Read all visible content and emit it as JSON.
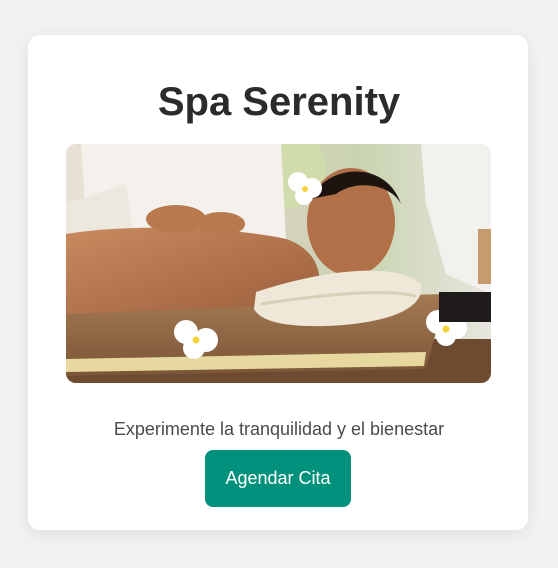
{
  "card": {
    "title": "Spa Serenity",
    "image": {
      "subject": "woman receiving back massage on a towel with white plumeria flowers"
    },
    "tagline": "Experimente la tranquilidad y el bienestar",
    "cta_label": "Agendar Cita"
  },
  "colors": {
    "page_background": "#f2f2f2",
    "card_background": "#ffffff",
    "title_text": "#2b2b2b",
    "body_text": "#4a4a4a",
    "button_background": "#00917c",
    "button_text": "#ffffff"
  }
}
